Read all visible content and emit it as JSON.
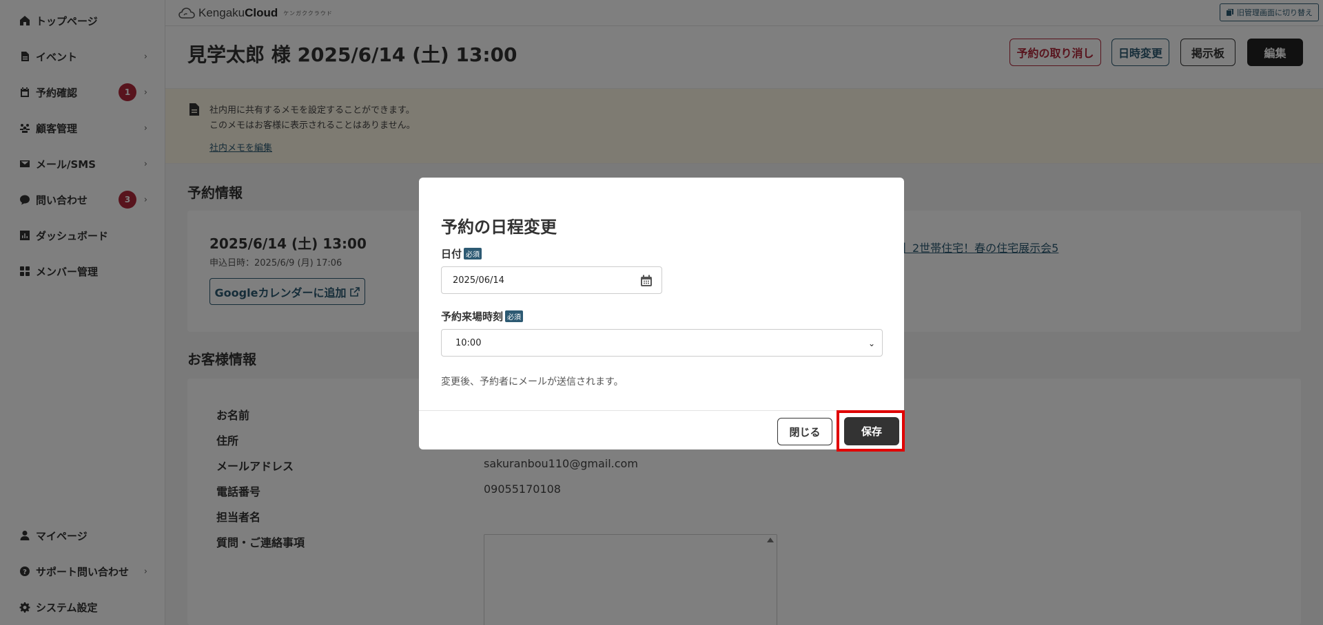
{
  "sidebar": {
    "items": [
      {
        "label": "トップページ",
        "icon": "home-icon"
      },
      {
        "label": "イベント",
        "icon": "document-icon"
      },
      {
        "label": "予約確認",
        "icon": "calendar-icon",
        "badge": "1"
      },
      {
        "label": "顧客管理",
        "icon": "users-icon"
      },
      {
        "label": "メール/SMS",
        "icon": "mail-icon"
      },
      {
        "label": "問い合わせ",
        "icon": "chat-icon",
        "badge": "3"
      },
      {
        "label": "ダッシュボード",
        "icon": "chart-icon"
      },
      {
        "label": "メンバー管理",
        "icon": "grid-icon"
      }
    ],
    "bottom_items": [
      {
        "label": "マイページ",
        "icon": "person-icon"
      },
      {
        "label": "サポート問い合わせ",
        "icon": "help-icon"
      },
      {
        "label": "システム設定",
        "icon": "gear-icon"
      }
    ],
    "chevron": "›"
  },
  "header": {
    "logo_text": "Kengaku",
    "logo_bold": "Cloud",
    "logo_kana": "ケンガククラウド",
    "switch_label": "旧管理画面に切り替え"
  },
  "page": {
    "title": "見学太郎 様 2025/6/14 (土) 13:00",
    "buttons": {
      "cancel": "予約の取り消し",
      "reschedule": "日時変更",
      "board": "掲示板",
      "edit": "編集"
    }
  },
  "memo": {
    "line1": "社内用に共有するメモを設定することができます。",
    "line2": "このメモはお客様に表示されることはありません。",
    "link": "社内メモを編集"
  },
  "reservation": {
    "section_title": "予約情報",
    "date": "2025/6/14 (土) 13:00",
    "applied": "申込日時：2025/6/9 (月) 17:06",
    "gcal_label": "Googleカレンダーに追加",
    "event_link": "】2世帯住宅！春の住宅展示会5"
  },
  "customer": {
    "section_title": "お客様情報",
    "rows": [
      {
        "label": "お名前",
        "value": ""
      },
      {
        "label": "住所",
        "value": ""
      },
      {
        "label": "メールアドレス",
        "value": "sakuranbou110@gmail.com"
      },
      {
        "label": "電話番号",
        "value": "09055170108"
      },
      {
        "label": "担当者名",
        "value": ""
      },
      {
        "label": "質問・ご連絡事項",
        "value": ""
      }
    ]
  },
  "modal": {
    "title": "予約の日程変更",
    "date_label": "日付",
    "required": "必須",
    "date_value": "2025/06/14",
    "time_label": "予約来場時刻",
    "time_value": "10:00",
    "notice": "変更後、予約者にメールが送信されます。",
    "close_label": "閉じる",
    "save_label": "保存"
  },
  "colors": {
    "accent": "#2d5a73",
    "danger": "#b0283b",
    "highlight": "#e00000"
  }
}
